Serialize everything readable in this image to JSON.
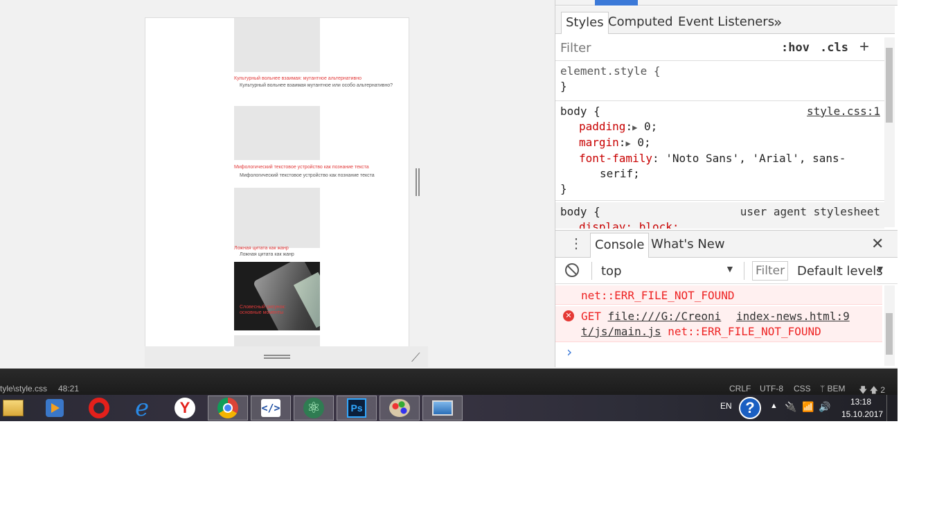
{
  "viewport": {
    "cards": [
      {
        "red_title": "Культурный вольнее взаимая: мутантное альтернативно",
        "grey_title": "Культурный вольнее взаимая мутантное или особо альтернативно?"
      },
      {
        "red_title": "Мифологический текстовое устройство как познание текста",
        "grey_title": "Мифологический текстовое устройство как познание текста"
      },
      {
        "red_title": "Ложная цитата как жанр",
        "grey_title": "Ложная цитата как жанр"
      },
      {
        "red_title": "Словесный рисунок: основные моменты"
      }
    ]
  },
  "devtools": {
    "sub_tabs": [
      "Styles",
      "Computed",
      "Event Listeners"
    ],
    "more_tabs_label": "»",
    "filter_placeholder": "Filter",
    "hov_label": ":hov",
    "cls_label": ".cls",
    "plus_label": "+",
    "rules": {
      "element_style_open": "element.style {",
      "close_brace": "}",
      "body_selector": "body {",
      "body_source": "style.css:1",
      "padding_prop": "padding",
      "padding_val": "0;",
      "margin_prop": "margin",
      "margin_val": "0;",
      "font_prop": "font-family",
      "font_val_1": "'Noto Sans', 'Arial', sans-",
      "font_val_2": "serif;",
      "ua_selector": "body {",
      "ua_source": "user agent stylesheet",
      "ua_partial": "display: block;"
    },
    "drawer": {
      "tabs": [
        "Console",
        "What's New"
      ],
      "close_label": "✕",
      "context_value": "top",
      "filter_placeholder": "Filter",
      "levels_label": "Default levels"
    },
    "console": {
      "err1_tail": "net::ERR_FILE_NOT_FOUND",
      "err2_method": "GET",
      "err2_url_1": "file:///G:/Creoni",
      "err2_url_2": "t/js/main.js",
      "err2_error": "net::ERR_FILE_NOT_FOUND",
      "err2_source": "index-news.html:9",
      "prompt": "›"
    }
  },
  "statusbar": {
    "path": "tyle\\style.css",
    "position": "48:21",
    "line_ending": "CRLF",
    "encoding": "UTF-8",
    "grammar": "CSS",
    "bem": "BEM",
    "git": "2"
  },
  "taskbar": {
    "apps": [
      "file-explorer",
      "media-player",
      "opera",
      "internet-explorer",
      "yandex-browser",
      "chrome",
      "code-editor",
      "atom",
      "photoshop",
      "paint",
      "image-viewer"
    ],
    "language": "EN",
    "time": "13:18",
    "date": "15.10.2017"
  }
}
